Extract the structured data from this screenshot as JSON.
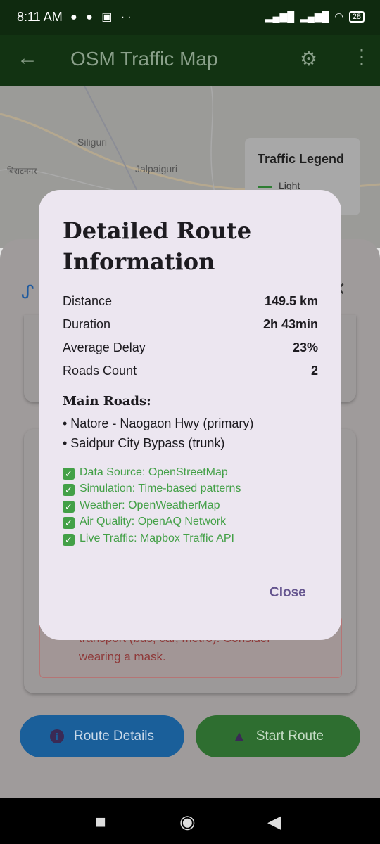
{
  "status_bar": {
    "time": "8:11 AM",
    "battery": "28"
  },
  "app_bar": {
    "title": "OSM Traffic Map"
  },
  "map": {
    "labels": [
      "Siliguri",
      "Jalpaiguri",
      "बिराटनगर"
    ]
  },
  "legend": {
    "title": "Traffic Legend",
    "item": "Light"
  },
  "background": {
    "warning_line1": "transport (bus, car, metro). Consider",
    "warning_line2": "wearing a mask."
  },
  "buttons": {
    "route_details": "Route Details",
    "start_route": "Start Route"
  },
  "dialog": {
    "title": "Detailed Route Information",
    "stats": [
      {
        "label": "Distance",
        "value": "149.5 km"
      },
      {
        "label": "Duration",
        "value": "2h 43min"
      },
      {
        "label": "Average Delay",
        "value": "23%"
      },
      {
        "label": "Roads Count",
        "value": "2"
      }
    ],
    "main_roads_title": "Main Roads:",
    "roads": [
      "• Natore - Naogaon Hwy (primary)",
      "• Saidpur City Bypass (trunk)"
    ],
    "info": [
      "Data Source: OpenStreetMap",
      "Simulation: Time-based patterns",
      "Weather: OpenWeatherMap",
      "Air Quality: OpenAQ Network",
      "Live Traffic: Mapbox Traffic API"
    ],
    "close_label": "Close"
  }
}
